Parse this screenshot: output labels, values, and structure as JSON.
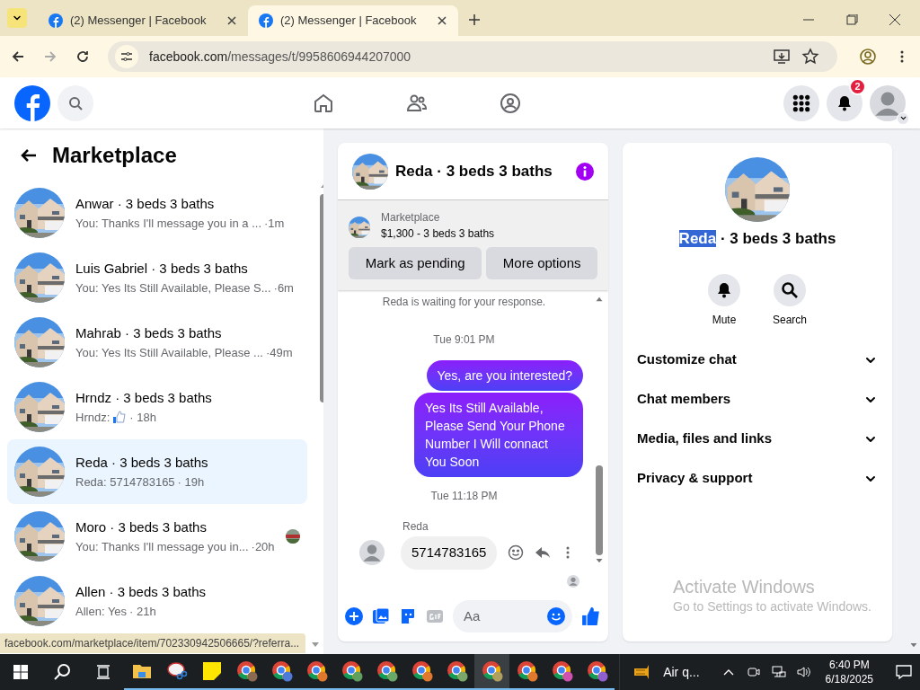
{
  "browser": {
    "tabs": [
      {
        "title": "(2) Messenger | Facebook",
        "selected": false
      },
      {
        "title": "(2) Messenger | Facebook",
        "selected": true
      }
    ],
    "url_host": "facebook.com",
    "url_path": "/messages/t/9958606944207000"
  },
  "header": {
    "notifications": "2"
  },
  "sidebar": {
    "title": "Marketplace",
    "conversations": [
      {
        "name": "Anwar · 3 beds 3 baths",
        "preview": "You: Thanks I'll message you in a ...",
        "time": "·1m",
        "selected": false,
        "like": false,
        "seen": false
      },
      {
        "name": "Luis Gabriel · 3 beds 3 baths",
        "preview": "You: Yes Its Still Available, Please S...",
        "time": "·6m",
        "selected": false,
        "like": false,
        "seen": false
      },
      {
        "name": "Mahrab · 3 beds 3 baths",
        "preview": "You: Yes Its Still Available, Please ...",
        "time": "·49m",
        "selected": false,
        "like": false,
        "seen": false
      },
      {
        "name": "Hrndz · 3 beds 3 baths",
        "preview": "Hrndz:",
        "time": "· 18h",
        "selected": false,
        "like": true,
        "seen": false
      },
      {
        "name": "Reda · 3 beds 3 baths",
        "preview": "Reda: 5714783165",
        "time": "· 19h",
        "selected": true,
        "like": false,
        "seen": false
      },
      {
        "name": "Moro · 3 beds 3 baths",
        "preview": "You: Thanks I'll message you in...",
        "time": "·20h",
        "selected": false,
        "like": false,
        "seen": true
      },
      {
        "name": "Allen · 3 beds 3 baths",
        "preview": "Allen: Yes",
        "time": "· 21h",
        "selected": false,
        "like": false,
        "seen": false
      }
    ]
  },
  "chat": {
    "title": "Reda · 3 beds 3 baths",
    "listing_label": "Marketplace",
    "listing": "$1,300 - 3 beds 3 baths",
    "buttons": [
      "Mark as pending",
      "More options"
    ],
    "messages": [
      {
        "kind": "notice",
        "text": "Reda is waiting for your response."
      },
      {
        "kind": "timestamp",
        "text": "Tue 9:01 PM"
      },
      {
        "kind": "outgoing",
        "text": "Yes, are you interested?"
      },
      {
        "kind": "outgoing",
        "text": "Yes Its Still Available, Please Send Your Phone Number I Will connact You Soon"
      },
      {
        "kind": "timestamp",
        "text": "Tue 11:18 PM"
      },
      {
        "kind": "incoming",
        "sender": "Reda",
        "text": "5714783165"
      }
    ],
    "composer": {
      "placeholder": "Aa"
    }
  },
  "info": {
    "title_parts": [
      {
        "text": "Reda",
        "selected": true
      },
      {
        "text": " · 3 beds 3 baths",
        "selected": false
      }
    ],
    "actions": [
      {
        "label": "Mute",
        "kind": "bell"
      },
      {
        "label": "Search",
        "kind": "search"
      }
    ],
    "sections": [
      {
        "label": "Customize chat",
        "expanded": false
      },
      {
        "label": "Chat members",
        "expanded": false
      },
      {
        "label": "Media, files and links",
        "expanded": false
      },
      {
        "label": "Privacy & support",
        "expanded": false
      }
    ]
  },
  "activation": {
    "title": "Activate Windows",
    "subtitle": "Go to Settings to activate Windows."
  },
  "status_link": "facebook.com/marketplace/item/702330942506665/?referra...",
  "taskbar": {
    "browsers": [
      {
        "color": "#8a6a50",
        "selected": false
      },
      {
        "color": "#4f7bd8",
        "selected": false
      },
      {
        "color": "#e0782e",
        "selected": false
      },
      {
        "color": "#5fa05f",
        "selected": false
      },
      {
        "color": "#6aa86a",
        "selected": false
      },
      {
        "color": "#e0782e",
        "selected": false
      },
      {
        "color": "#7aa86a",
        "selected": false
      },
      {
        "color": "#b0a060",
        "selected": true
      },
      {
        "color": "#e0782e",
        "selected": false
      },
      {
        "color": "#d050b0",
        "selected": false
      },
      {
        "color": "#9060d0",
        "selected": false
      }
    ],
    "weather": "Air q...",
    "time": "6:40 PM",
    "date": "6/18/2025"
  }
}
